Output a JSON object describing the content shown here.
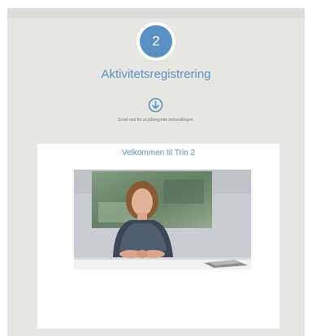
{
  "step": {
    "number": "2"
  },
  "header": {
    "title": "Aktivitetsregistrering",
    "scroll_hint": "Scroll ned for at påbegynde behandlingen."
  },
  "icons": {
    "scroll": "arrow-down-circle-icon"
  },
  "card": {
    "title": "Velkommen til Trin 2"
  },
  "colors": {
    "accent": "#5b90c4",
    "background": "#e6e6e3",
    "card": "#ffffff"
  }
}
